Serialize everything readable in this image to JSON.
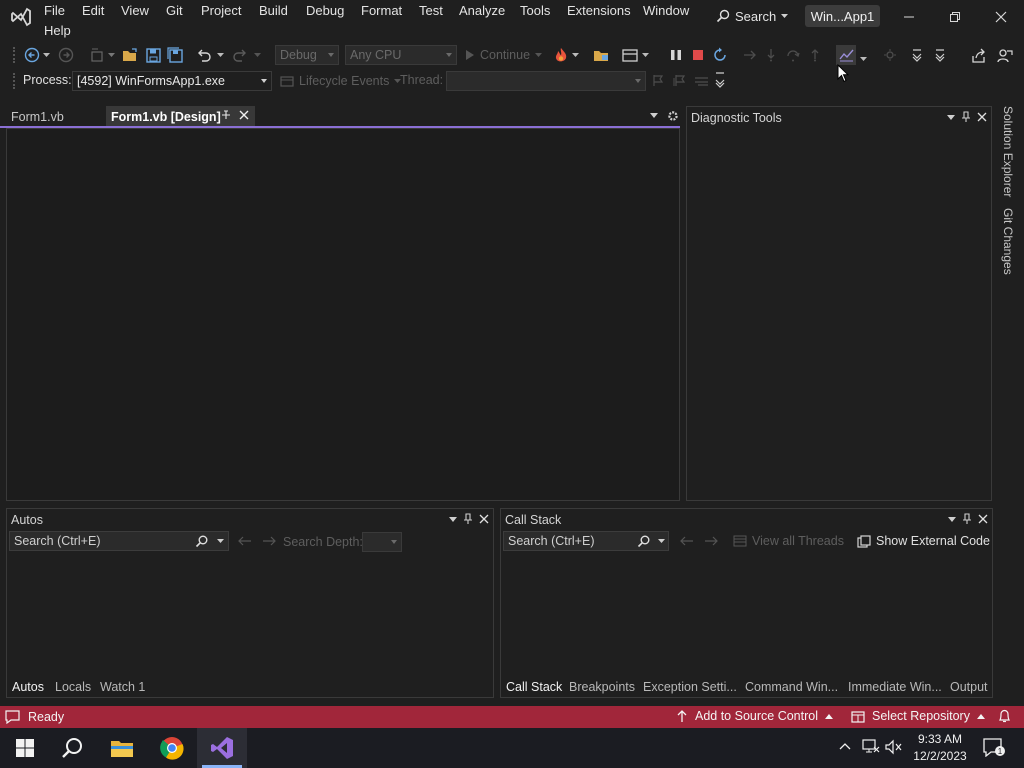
{
  "menu": {
    "items": [
      "File",
      "Edit",
      "View",
      "Git",
      "Project",
      "Build",
      "Debug",
      "Format",
      "Test",
      "Analyze",
      "Tools",
      "Extensions",
      "Window"
    ],
    "help": "Help",
    "search_label": "Search",
    "solution_title": "Win...App1"
  },
  "toolbar": {
    "config": "Debug",
    "platform": "Any CPU",
    "continue_label": "Continue",
    "process_label": "Process:",
    "process_value": "[4592] WinFormsApp1.exe",
    "lifecycle_label": "Lifecycle Events",
    "thread_label": "Thread:"
  },
  "editor": {
    "tabs": [
      {
        "label": "Form1.vb"
      },
      {
        "label": "Form1.vb [Design]"
      }
    ]
  },
  "diagnostics": {
    "title": "Diagnostic Tools"
  },
  "side_rail": {
    "items": [
      "Solution Explorer",
      "Git Changes"
    ]
  },
  "autos": {
    "title": "Autos",
    "search_placeholder": "Search (Ctrl+E)",
    "search_depth_label": "Search Depth:",
    "tabs": [
      "Autos",
      "Locals",
      "Watch 1"
    ]
  },
  "callstack": {
    "title": "Call Stack",
    "search_placeholder": "Search (Ctrl+E)",
    "view_threads_label": "View all Threads",
    "show_external_label": "Show External Code",
    "tabs": [
      "Call Stack",
      "Breakpoints",
      "Exception Setti...",
      "Command Win...",
      "Immediate Win...",
      "Output"
    ]
  },
  "status": {
    "ready": "Ready",
    "add_source_control": "Add to Source Control",
    "select_repository": "Select Repository"
  },
  "taskbar": {
    "time": "9:33 AM",
    "date": "12/2/2023"
  },
  "colors": {
    "status_bar": "#a1263a",
    "accent": "#8a6fd4",
    "stop_red": "#e04a4a",
    "taskbar": "#1b1c22"
  }
}
